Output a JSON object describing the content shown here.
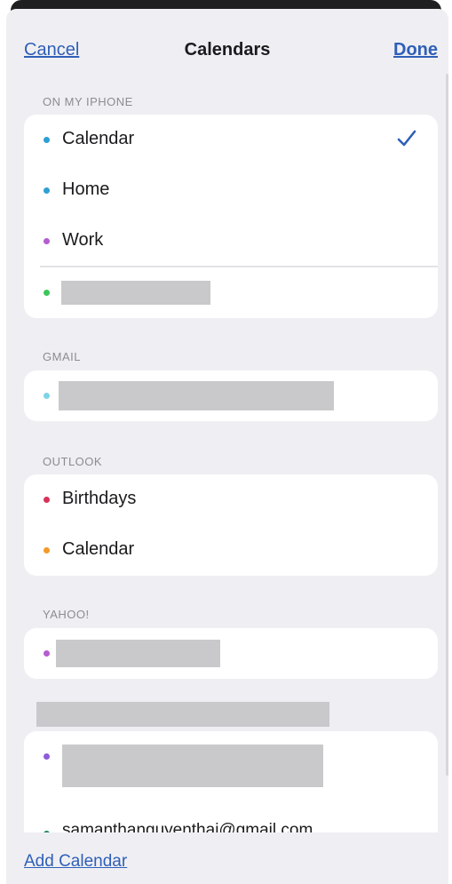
{
  "nav": {
    "cancel_label": "Cancel",
    "title": "Calendars",
    "done_label": "Done"
  },
  "sections": {
    "on_my_iphone": {
      "header": "ON MY IPHONE",
      "items": [
        {
          "label": "Calendar",
          "color": "#2e9fd1",
          "selected": true
        },
        {
          "label": "Home",
          "color": "#2e9fd1"
        },
        {
          "label": "Work",
          "color": "#b55ccf"
        },
        {
          "label": "",
          "color": "#3cc65a",
          "redacted": true
        }
      ]
    },
    "gmail": {
      "header": "GMAIL",
      "items": [
        {
          "label": "",
          "color": "#7fd3e6",
          "redacted": true
        }
      ]
    },
    "outlook": {
      "header": "OUTLOOK",
      "items": [
        {
          "label": "Birthdays",
          "color": "#d6335a"
        },
        {
          "label": "Calendar",
          "color": "#f29a2a"
        }
      ]
    },
    "yahoo": {
      "header": "YAHOO!",
      "items": [
        {
          "label": "",
          "color": "#b55ccf",
          "redacted": true
        }
      ]
    },
    "other": {
      "header": "",
      "items": [
        {
          "label": "",
          "color": "#8e5cd8",
          "redacted": true
        },
        {
          "label": "samanthanguyenthai@gmail.com",
          "color": "#1f8a5a"
        }
      ]
    }
  },
  "footer": {
    "add_calendar_label": "Add Calendar"
  },
  "colors": {
    "accent": "#2f5fb7",
    "background": "#efeff3",
    "card": "#ffffff",
    "redaction": "#c9c9cc"
  },
  "icons": {
    "checkmark": "checkmark-icon"
  }
}
